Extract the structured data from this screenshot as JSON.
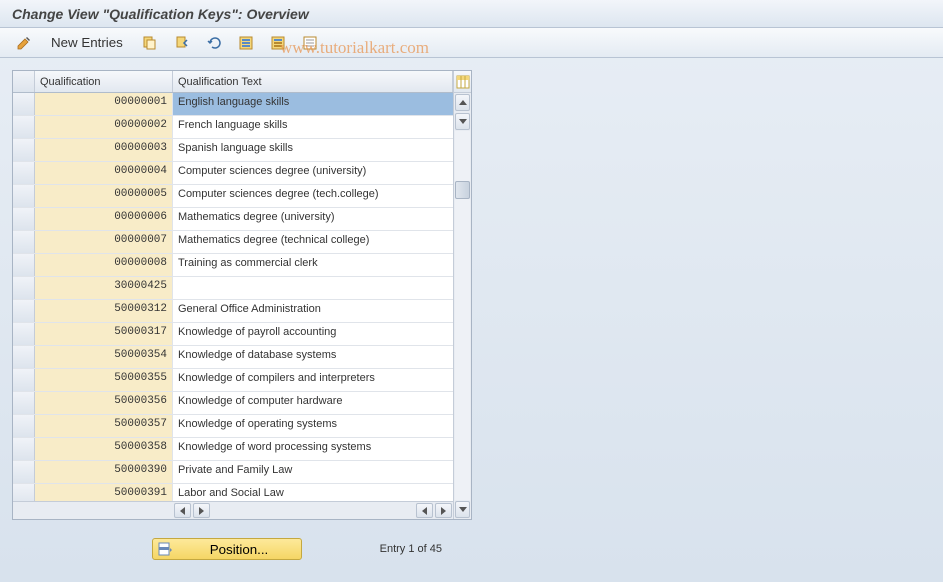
{
  "title": "Change View \"Qualification Keys\": Overview",
  "watermark": "www.tutorialkart.com",
  "toolbar": {
    "new_entries_label": "New Entries"
  },
  "grid": {
    "columns": {
      "qualification": "Qualification",
      "qualification_text": "Qualification Text"
    },
    "selected_index": 0,
    "rows": [
      {
        "code": "00000001",
        "text": "English language skills"
      },
      {
        "code": "00000002",
        "text": "French language skills"
      },
      {
        "code": "00000003",
        "text": "Spanish language skills"
      },
      {
        "code": "00000004",
        "text": "Computer sciences degree (university)"
      },
      {
        "code": "00000005",
        "text": "Computer sciences degree (tech.college)"
      },
      {
        "code": "00000006",
        "text": "Mathematics degree (university)"
      },
      {
        "code": "00000007",
        "text": "Mathematics degree (technical college)"
      },
      {
        "code": "00000008",
        "text": "Training as commercial clerk"
      },
      {
        "code": "30000425",
        "text": ""
      },
      {
        "code": "50000312",
        "text": "General Office Administration"
      },
      {
        "code": "50000317",
        "text": "Knowledge of payroll accounting"
      },
      {
        "code": "50000354",
        "text": "Knowledge of database systems"
      },
      {
        "code": "50000355",
        "text": "Knowledge of compilers and interpreters"
      },
      {
        "code": "50000356",
        "text": "Knowledge of computer hardware"
      },
      {
        "code": "50000357",
        "text": "Knowledge of operating systems"
      },
      {
        "code": "50000358",
        "text": "Knowledge of word processing systems"
      },
      {
        "code": "50000390",
        "text": "Private and Family Law"
      },
      {
        "code": "50000391",
        "text": "Labor and Social Law"
      }
    ]
  },
  "footer": {
    "position_label": "Position...",
    "entry_info": "Entry 1 of 45"
  }
}
